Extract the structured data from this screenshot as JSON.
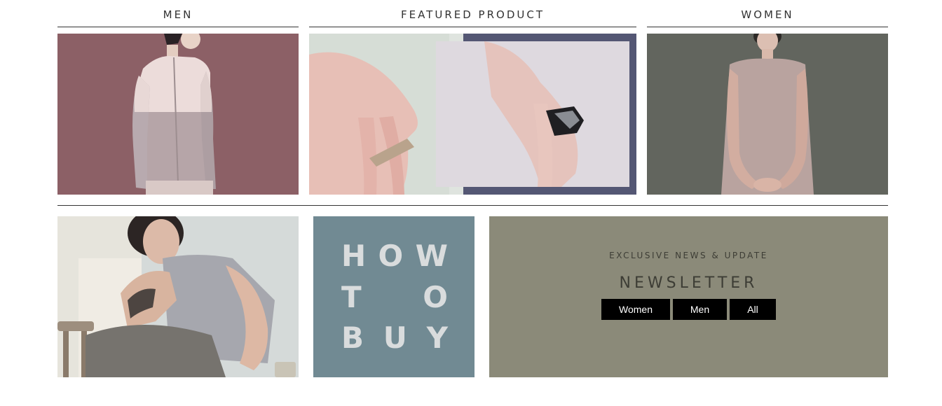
{
  "columns": {
    "men": "MEN",
    "featured": "FEATURED PRODUCT",
    "women": "WOMEN"
  },
  "how_to_buy": {
    "row1": [
      "H",
      "O",
      "W"
    ],
    "row2": [
      "T",
      "O"
    ],
    "row3": [
      "B",
      "U",
      "Y"
    ]
  },
  "newsletter": {
    "kicker": "EXCLUSIVE NEWS & UPDATE",
    "title": "NEWSLETTER",
    "buttons": [
      "Women",
      "Men",
      "All"
    ]
  },
  "colors": {
    "men_bg": "#8c6066",
    "featured_frame": "#545774",
    "women_bg": "#62655e",
    "howto_bg": "#718a93",
    "newsletter_bg": "#8b8a79",
    "button_bg": "#000000"
  }
}
